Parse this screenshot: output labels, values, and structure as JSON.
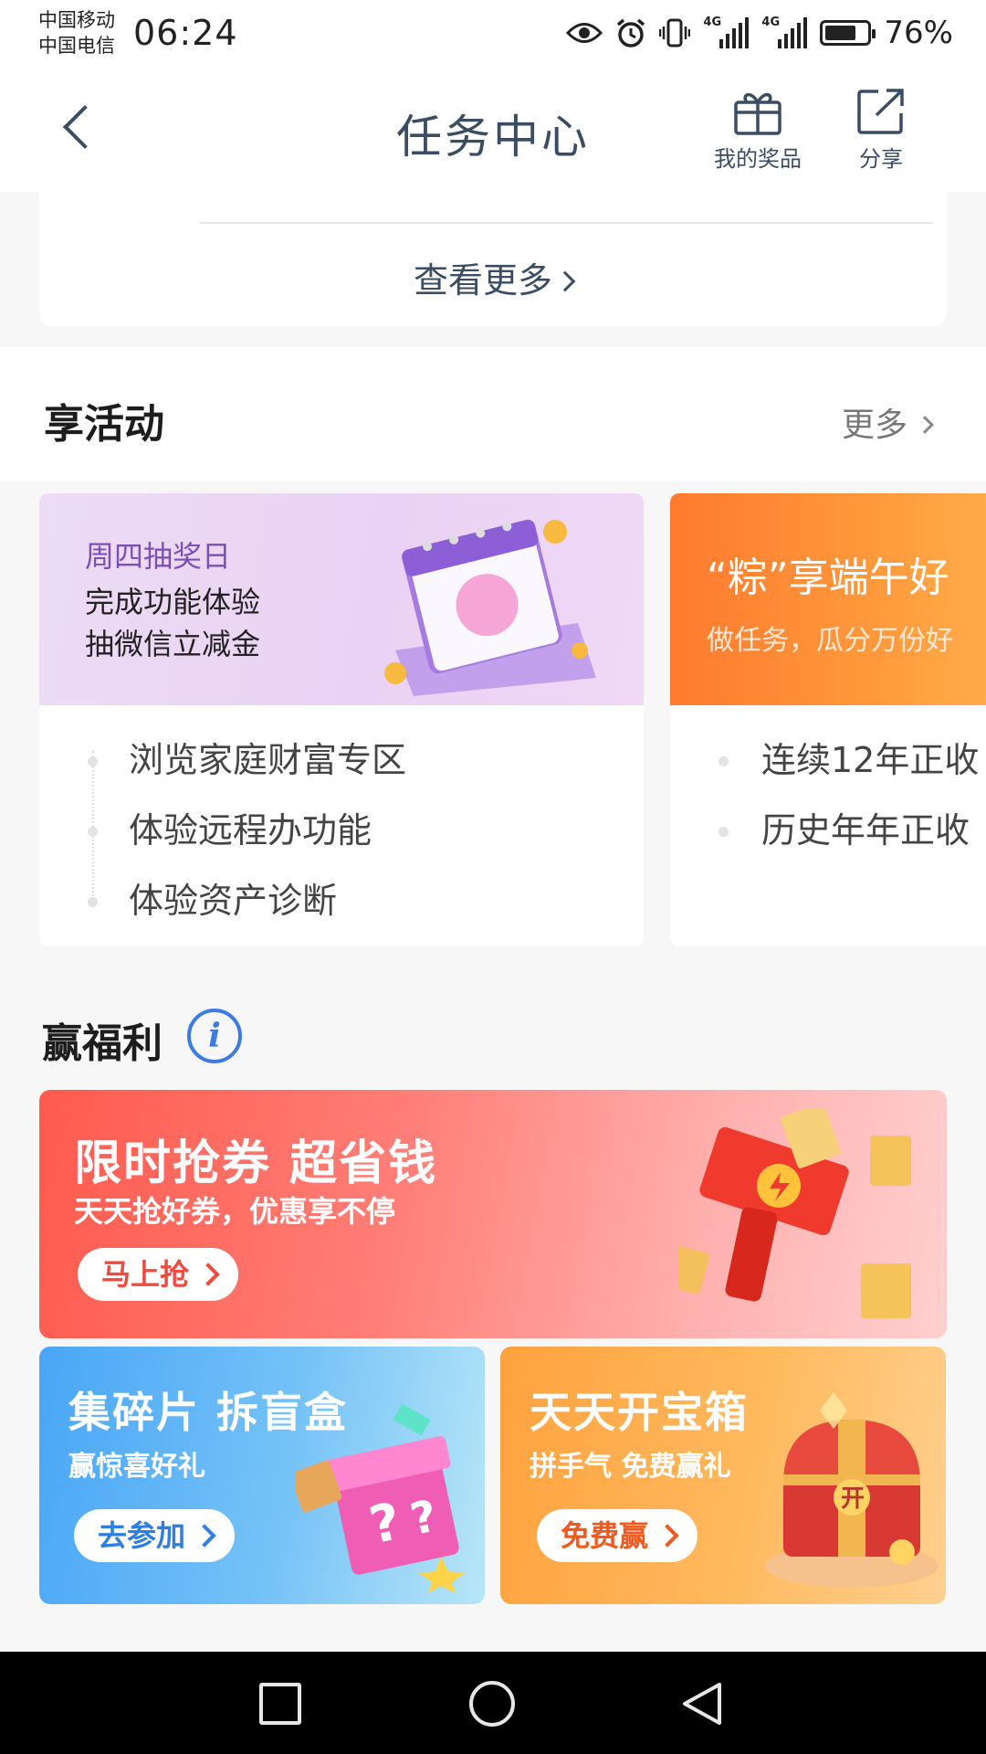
{
  "status_bar": {
    "carrier1": "中国移动",
    "carrier2": "中国电信",
    "time": "06:24",
    "network1": "4G",
    "network2": "4G",
    "battery_percent": "76%",
    "battery_level": 0.76,
    "icons": [
      "eye-icon",
      "alarm-icon",
      "vibrate-icon",
      "signal-icon",
      "battery-icon"
    ]
  },
  "nav": {
    "title": "任务中心",
    "prizes_label": "我的奖品",
    "share_label": "分享"
  },
  "top_card": {
    "view_more": "查看更多"
  },
  "activities": {
    "title": "享活动",
    "more": "更多",
    "cards": [
      {
        "tag": "周四抽奖日",
        "line1": "完成功能体验",
        "line2": "抽微信立减金",
        "tasks": [
          "浏览家庭财富专区",
          "体验远程办功能",
          "体验资产诊断"
        ]
      },
      {
        "title": "“粽”享端午好",
        "subtitle": "做任务，瓜分万份好",
        "tasks": [
          "连续12年正收",
          "历史年年正收"
        ]
      }
    ]
  },
  "benefits": {
    "title": "赢福利",
    "coupon": {
      "title": "限时抢券 超省钱",
      "subtitle": "天天抢好券，优惠享不停",
      "button": "马上抢"
    },
    "blindbox": {
      "title": "集碎片 拆盲盒",
      "subtitle": "赢惊喜好礼",
      "button": "去参加"
    },
    "treasure": {
      "title": "天天开宝箱",
      "subtitle": "拼手气 免费赢礼",
      "button": "免费赢",
      "chest_label": "开"
    }
  },
  "colors": {
    "nav_text": "#3a4d63",
    "info_blue": "#3d7be0",
    "coupon_red": "#f04a3f",
    "blind_blue": "#2f7fe0",
    "chest_orange": "#f05a1f"
  }
}
